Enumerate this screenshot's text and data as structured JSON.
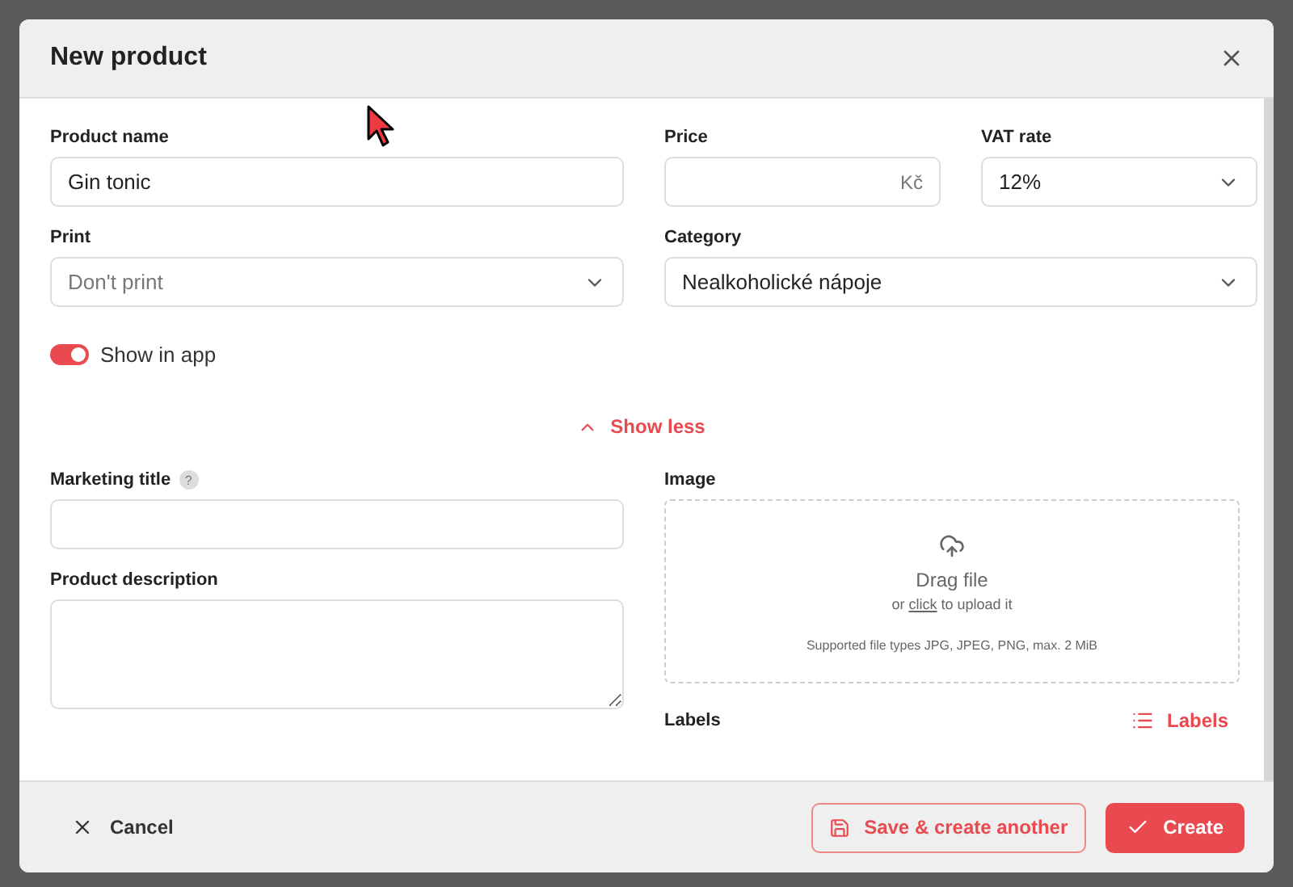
{
  "dialog": {
    "title": "New product"
  },
  "fields": {
    "product_name": {
      "label": "Product name",
      "value": "Gin tonic"
    },
    "price": {
      "label": "Price",
      "suffix": "Kč"
    },
    "vat_rate": {
      "label": "VAT rate",
      "value": "12%"
    },
    "print": {
      "label": "Print",
      "placeholder": "Don't print"
    },
    "category": {
      "label": "Category",
      "value": "Nealkoholické nápoje"
    }
  },
  "show_in_app": {
    "label": "Show in app",
    "on": true
  },
  "toggle_details": {
    "label": "Show less",
    "expanded": true
  },
  "marketing_title": {
    "label": "Marketing title",
    "help": "?"
  },
  "product_description": {
    "label": "Product description"
  },
  "image": {
    "label": "Image",
    "drop_title": "Drag file",
    "drop_hint_before": "or ",
    "drop_link": "click",
    "drop_hint_after": " to upload it",
    "supported": "Supported file types JPG, JPEG, PNG, max. 2 MiB"
  },
  "labels": {
    "label": "Labels",
    "button": "Labels"
  },
  "footer": {
    "cancel": "Cancel",
    "save_another": "Save & create another",
    "create": "Create"
  }
}
